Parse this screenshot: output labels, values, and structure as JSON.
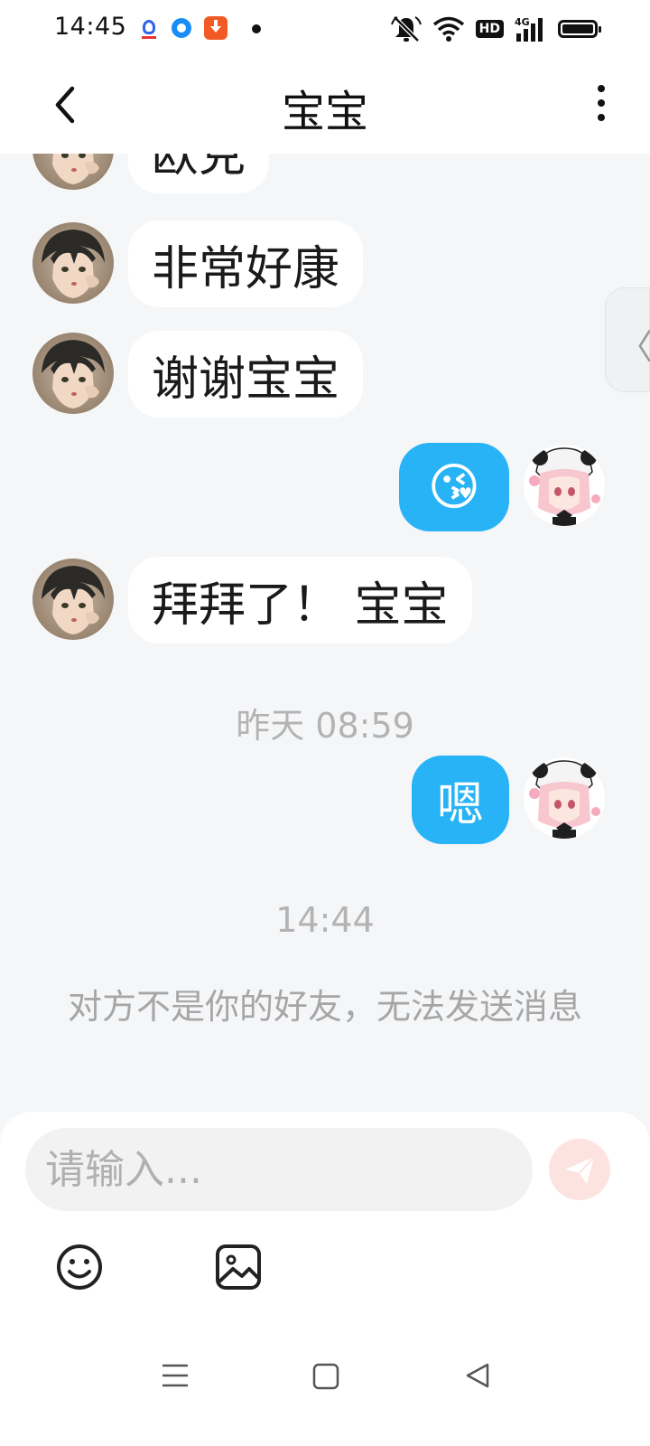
{
  "status_bar": {
    "time": "14:45",
    "icons": [
      "baidu-app-icon",
      "blue-circle-app-icon",
      "download-app-icon",
      "notification-dot",
      "mute-bell-icon",
      "wifi-icon",
      "hd-badge",
      "4g-signal-icon",
      "battery-icon"
    ],
    "hd_label": "HD",
    "network_label": "4G"
  },
  "header": {
    "title": "宝宝",
    "back_icon": "chevron-left-icon",
    "more_icon": "more-vertical-icon"
  },
  "messages": [
    {
      "side": "in",
      "text": "欧克"
    },
    {
      "side": "in",
      "text": "非常好康"
    },
    {
      "side": "in",
      "text": "谢谢宝宝"
    },
    {
      "side": "out",
      "text": "😘"
    },
    {
      "side": "in",
      "text": "拜拜了！ 宝宝"
    },
    {
      "type": "time",
      "text": "昨天 08:59"
    },
    {
      "side": "out",
      "text": "嗯"
    },
    {
      "type": "time",
      "text": "14:44"
    },
    {
      "type": "notice",
      "text": "对方不是你的好友，无法发送消息"
    }
  ],
  "side_handle": {
    "glyph": "〈"
  },
  "composer": {
    "placeholder": "请输入...",
    "send_icon": "send-paper-plane-icon",
    "tools": [
      "emoji-smile-icon",
      "image-picture-icon"
    ]
  },
  "nav": {
    "buttons": [
      "menu-icon",
      "home-square-icon",
      "back-triangle-icon"
    ]
  },
  "colors": {
    "outgoing_bubble": "#27b3f5",
    "incoming_bubble": "#ffffff",
    "background": "#f5f6f8",
    "send_button": "#fde3e0"
  }
}
